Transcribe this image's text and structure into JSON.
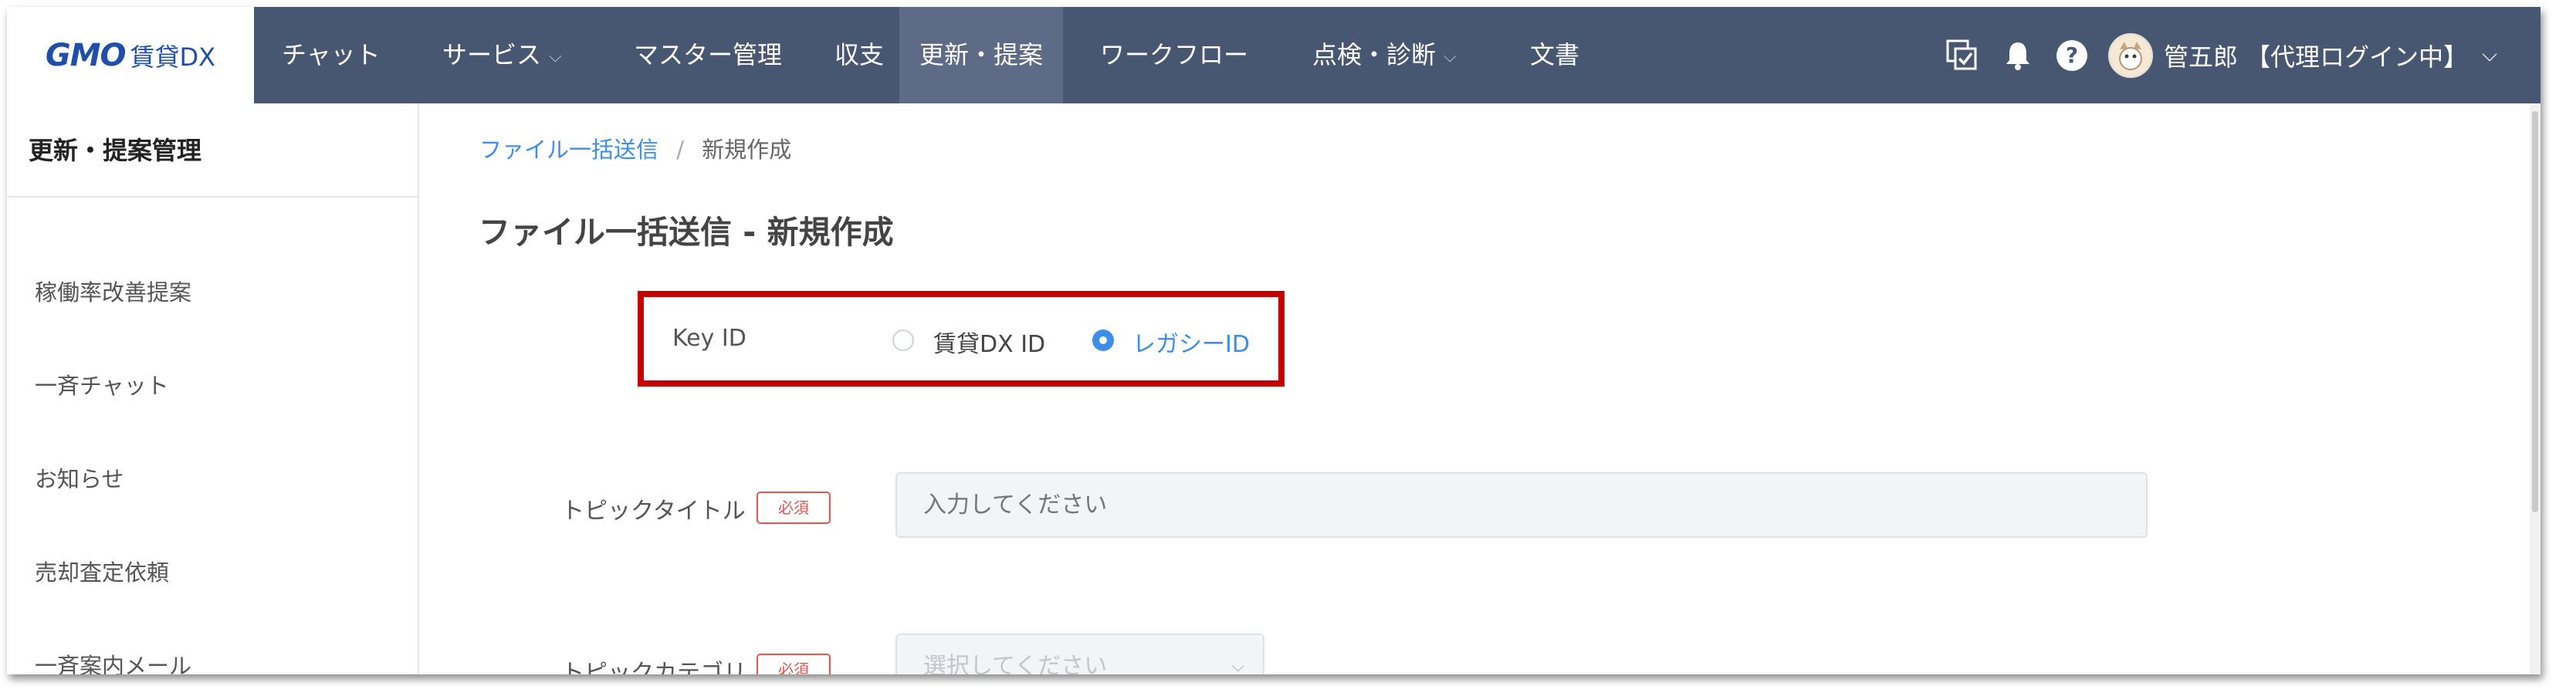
{
  "brand": {
    "logo": "GMO",
    "logo_sub": "賃貸DX"
  },
  "nav": {
    "items": [
      {
        "label": "チャット"
      },
      {
        "label": "サービス"
      },
      {
        "label": "マスター管理"
      },
      {
        "label": "収支"
      },
      {
        "label": "更新・提案"
      },
      {
        "label": "ワークフロー"
      },
      {
        "label": "点検・診断"
      },
      {
        "label": "文書"
      }
    ],
    "active_item": "更新・提案",
    "help_symbol": "?",
    "user_label": "管五郎 【代理ログイン中】"
  },
  "sidebar": {
    "title": "更新・提案管理",
    "items": [
      {
        "label": "稼働率改善提案"
      },
      {
        "label": "一斉チャット"
      },
      {
        "label": "お知らせ"
      },
      {
        "label": "売却査定依頼"
      },
      {
        "label": "一斉案内メール"
      }
    ]
  },
  "breadcrumb": {
    "parent": "ファイル一括送信",
    "separator": "/",
    "current": "新規作成"
  },
  "page": {
    "title": "ファイル一括送信 - 新規作成"
  },
  "form": {
    "key_id": {
      "label": "Key ID",
      "options": [
        {
          "label": "賃貸DX ID",
          "selected": false
        },
        {
          "label": "レガシーID",
          "selected": true
        }
      ]
    },
    "topic_title": {
      "label": "トピックタイトル",
      "required_badge": "必須",
      "placeholder": "入力してください"
    },
    "topic_category": {
      "label": "トピックカテゴリ",
      "required_badge": "必須",
      "placeholder": "選択してください"
    }
  },
  "colors": {
    "nav_bg": "#475771",
    "nav_active_bg": "#5d6b86",
    "accent": "#3d8ee8",
    "highlight_box": "#c40000",
    "required": "#e25555"
  },
  "icons": [
    "tasks-check-icon",
    "bell-icon",
    "help-icon",
    "avatar",
    "chevron-down-icon"
  ]
}
